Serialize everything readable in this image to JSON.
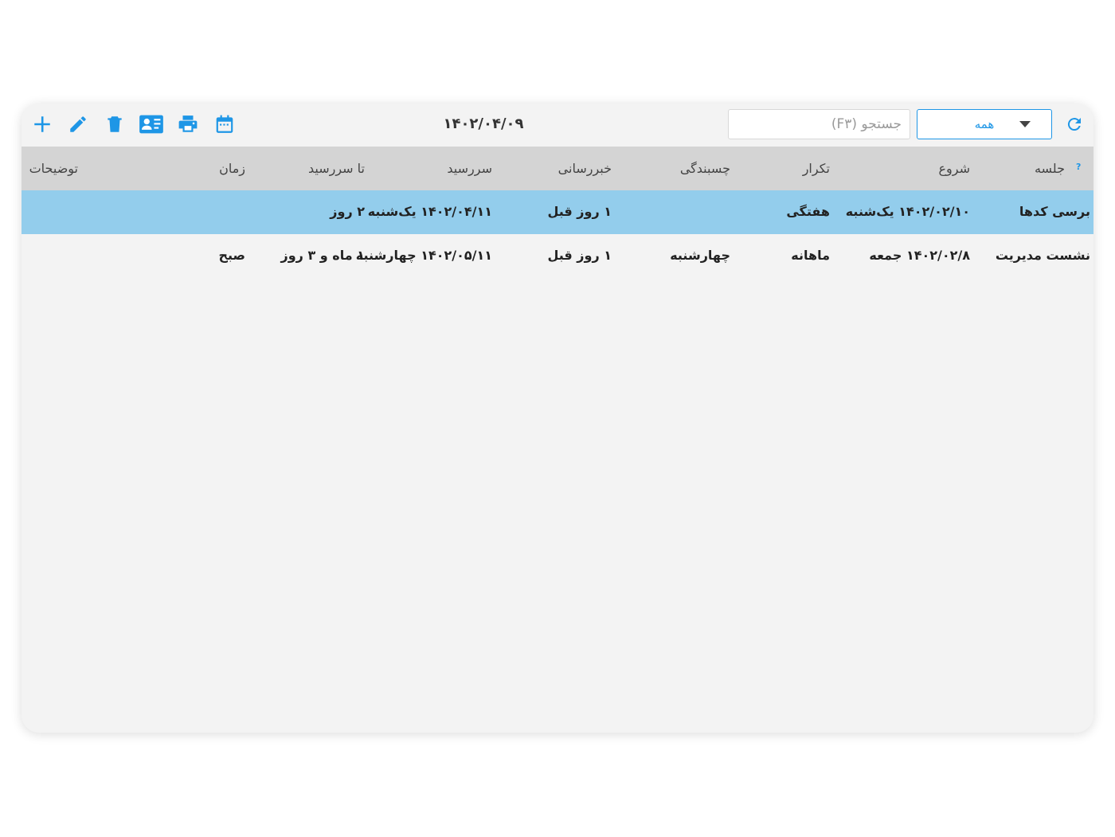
{
  "toolbar": {
    "date": "۱۴۰۲/۰۴/۰۹",
    "search_placeholder": "جستجو (F۳)",
    "filter_value": "همه",
    "accent_color": "#1e96e6",
    "icons": [
      "add-icon",
      "edit-icon",
      "delete-icon",
      "contact-card-icon",
      "print-icon",
      "calendar-icon",
      "refresh-icon"
    ]
  },
  "table": {
    "headers": {
      "session": "جلسه",
      "start": "شروع",
      "repeat": "تکرار",
      "sticky": "چسبندگی",
      "notify": "خبررسانی",
      "due": "سررسید",
      "until_due": "تا سررسید",
      "time": "زمان",
      "notes": "توضیحات"
    },
    "help": "?",
    "rows": [
      {
        "session": "برسی کدها",
        "start": "۱۴۰۲/۰۲/۱۰ یک‌شنبه",
        "repeat": "هفتگی",
        "sticky": "",
        "notify": "۱ روز قبل",
        "due": "۱۴۰۲/۰۴/۱۱ یک‌شنبه",
        "until_due": "۲ روز",
        "time": "",
        "notes": "",
        "selected": true
      },
      {
        "session": "نشست مدیریت",
        "start": "۱۴۰۲/۰۲/۸ جمعه",
        "repeat": "ماهانه",
        "sticky": "چهارشنبه",
        "notify": "۱ روز قبل",
        "due": "۱۴۰۲/۰۵/۱۱ چهارشنبه",
        "until_due": "۱ ماه و ۳ روز",
        "time": "صبح",
        "notes": "",
        "selected": false
      }
    ],
    "selected_row_color": "#93cdec",
    "header_bg_color": "#d4d4d4"
  }
}
